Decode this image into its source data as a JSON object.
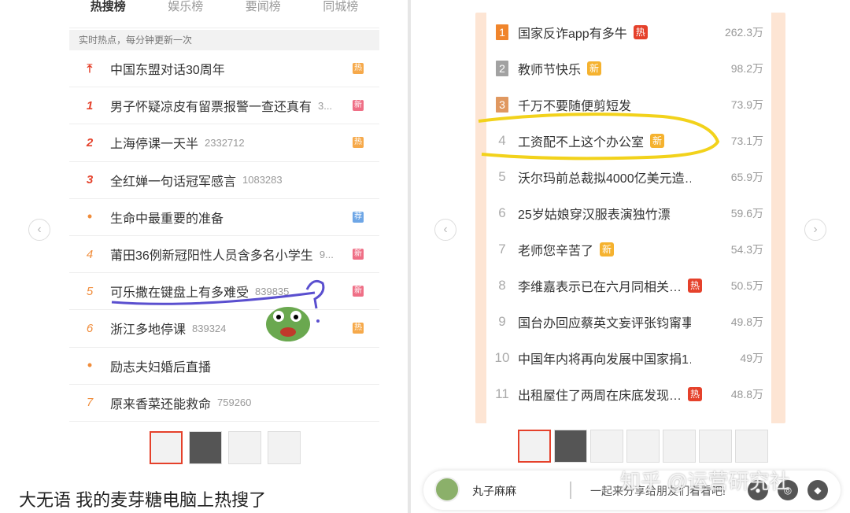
{
  "left": {
    "tabs": [
      "热搜榜",
      "娱乐榜",
      "要闻榜",
      "同城榜"
    ],
    "subtitle": "实时热点，每分钟更新一次",
    "rows": [
      {
        "rank": "pin",
        "title": "中国东盟对话30周年",
        "count": "",
        "badge": "热",
        "badge_type": "hot"
      },
      {
        "rank": "1",
        "title": "男子怀疑凉皮有留票报警一查还真有",
        "count": "3...",
        "badge": "新",
        "badge_type": "new"
      },
      {
        "rank": "2",
        "title": "上海停课一天半",
        "count": "2332712",
        "badge": "热",
        "badge_type": "hot"
      },
      {
        "rank": "3",
        "title": "全红婵一句话冠军感言",
        "count": "1083283",
        "badge": "",
        "badge_type": ""
      },
      {
        "rank": "dot",
        "title": "生命中最重要的准备",
        "count": "",
        "badge": "荐",
        "badge_type": "rec"
      },
      {
        "rank": "4",
        "title": "莆田36例新冠阳性人员含多名小学生",
        "count": "9...",
        "badge": "新",
        "badge_type": "new"
      },
      {
        "rank": "5",
        "title": "可乐撒在键盘上有多难受",
        "count": "839835",
        "badge": "新",
        "badge_type": "new"
      },
      {
        "rank": "6",
        "title": "浙江多地停课",
        "count": "839324",
        "badge": "热",
        "badge_type": "hot"
      },
      {
        "rank": "dot",
        "title": "励志夫妇婚后直播",
        "count": "",
        "badge": "",
        "badge_type": ""
      },
      {
        "rank": "7",
        "title": "原来香菜还能救命",
        "count": "759260",
        "badge": "",
        "badge_type": ""
      }
    ],
    "caption": "大无语 我的麦芽糖电脑上热搜了"
  },
  "right": {
    "rows": [
      {
        "rank": "1",
        "title": "国家反诈app有多牛",
        "badge": "热",
        "badge_type": "hot",
        "count": "262.3万"
      },
      {
        "rank": "2",
        "title": "教师节快乐",
        "badge": "新",
        "badge_type": "new",
        "count": "98.2万"
      },
      {
        "rank": "3",
        "title": "千万不要随便剪短发",
        "badge": "",
        "badge_type": "",
        "count": "73.9万"
      },
      {
        "rank": "4",
        "title": "工资配不上这个办公室",
        "badge": "新",
        "badge_type": "new",
        "count": "73.1万"
      },
      {
        "rank": "5",
        "title": "沃尔玛前总裁拟4000亿美元造…",
        "badge": "",
        "badge_type": "",
        "count": "65.9万"
      },
      {
        "rank": "6",
        "title": "25岁姑娘穿汉服表演独竹漂",
        "badge": "",
        "badge_type": "",
        "count": "59.6万"
      },
      {
        "rank": "7",
        "title": "老师您辛苦了",
        "badge": "新",
        "badge_type": "new",
        "count": "54.3万"
      },
      {
        "rank": "8",
        "title": "李维嘉表示已在六月同相关…",
        "badge": "热",
        "badge_type": "hot",
        "count": "50.5万"
      },
      {
        "rank": "9",
        "title": "国台办回应蔡英文妄评张钧甯事件",
        "badge": "",
        "badge_type": "",
        "count": "49.8万"
      },
      {
        "rank": "10",
        "title": "中国年内将再向发展中国家捐1…",
        "badge": "",
        "badge_type": "",
        "count": "49万"
      },
      {
        "rank": "11",
        "title": "出租屋住了两周在床底发现…",
        "badge": "热",
        "badge_type": "hot",
        "count": "48.8万"
      }
    ],
    "user_name": "丸子麻麻",
    "share_text": "一起来分享给朋友们看看吧!",
    "watermark": "知乎 @运营研究社"
  }
}
